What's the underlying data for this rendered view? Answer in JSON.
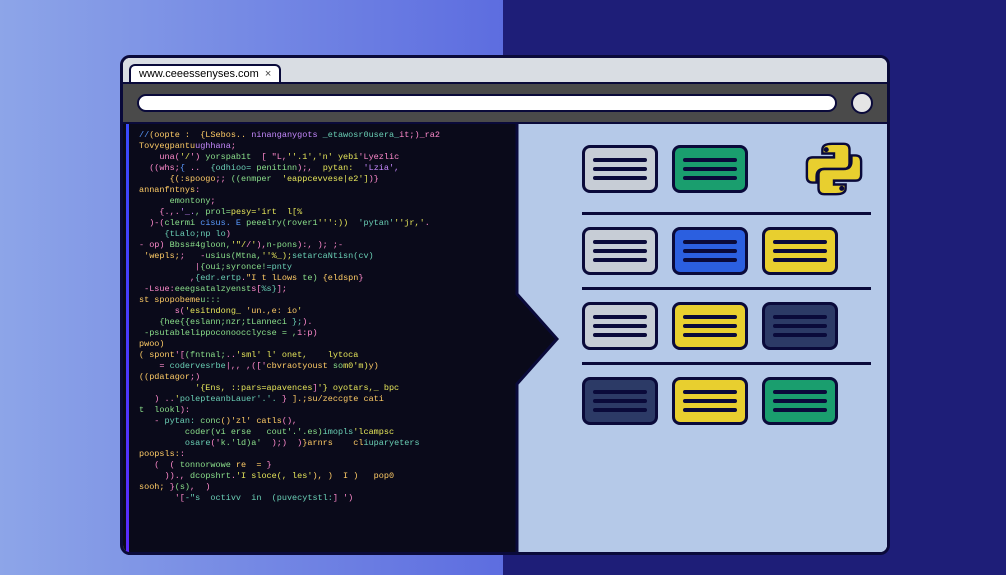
{
  "tab": {
    "url_label": "www.ceeessenyses.com",
    "close": "×"
  },
  "code": {
    "lines": [
      [
        [
          "kw",
          "//"
        ],
        [
          "cm",
          "(oopte :  {LSebos.. "
        ],
        [
          "var",
          "ninanganygots"
        ],
        [
          "op",
          " "
        ],
        [
          "ty",
          "_etawosr0usera_"
        ],
        [
          "op",
          "it;)_ra2"
        ]
      ],
      [
        [
          "cm",
          "Tovyegpantu"
        ],
        [
          "var",
          "ughhana"
        ],
        [
          "op",
          ";"
        ]
      ],
      [
        [
          "op",
          "    una("
        ],
        [
          "str",
          "'/"
        ],
        [
          "op",
          "')"
        ],
        [
          "fn",
          " yorspab1t  "
        ],
        [
          "op",
          "[ \"L,"
        ],
        [
          "str",
          "''.1','n' yebi"
        ],
        [
          "op",
          "'Lyezlic"
        ]
      ],
      [
        [
          "op",
          "  ((whs;"
        ],
        [
          "kw",
          "{"
        ],
        [
          "op",
          " ..  "
        ],
        [
          "ty",
          "{odhioo="
        ],
        [
          "fn",
          " penitinn"
        ],
        [
          "op",
          ");,  "
        ],
        [
          "str",
          "pytan:"
        ],
        [
          "var",
          "  'Lzia',"
        ]
      ],
      [
        [
          "cm",
          "      {(:spoogo"
        ],
        [
          "op",
          ";;"
        ],
        [
          "fn",
          " ((enmper"
        ],
        [
          "str",
          "  'eappcevvese|e2']"
        ],
        [
          "op",
          ")}"
        ]
      ],
      [
        [
          "cm",
          "annanfntnys"
        ],
        [
          "op",
          ":"
        ]
      ],
      [
        [
          "op",
          "      "
        ],
        [
          "fn",
          "emontony"
        ],
        [
          "op",
          ";"
        ]
      ],
      [
        [
          "op",
          "    {.,."
        ],
        [
          "var",
          "'_."
        ],
        [
          "fn",
          ", prol="
        ],
        [
          "str",
          "pesy='irt  l[%"
        ],
        [
          "op",
          ""
        ]
      ],
      [
        [
          "op",
          "  )-("
        ],
        [
          "fn",
          "clermi"
        ],
        [
          "kw",
          " cisus. E"
        ],
        [
          "fn",
          " peeelry(rover1"
        ],
        [
          "str",
          "''':))  "
        ],
        [
          "ty",
          "'pytan'"
        ],
        [
          "str",
          "''jr,'"
        ],
        [
          "op",
          "."
        ]
      ],
      [
        [
          "op",
          "     "
        ],
        [
          "ty",
          "{tLalo;np lo"
        ],
        [
          "op",
          ")"
        ]
      ],
      [
        [
          "op",
          "- op)"
        ],
        [
          "fn",
          " Bbss#4gloon,"
        ],
        [
          "str",
          "'\"/"
        ],
        [
          "op",
          "/"
        ],
        [
          "str",
          "'"
        ],
        [
          "op",
          "),"
        ],
        [
          "fn",
          "n-pons"
        ],
        [
          "op",
          "):, ); ;-"
        ]
      ],
      [
        [
          "cm",
          " 'wepls;"
        ],
        [
          "op",
          ";   -"
        ],
        [
          "fn",
          "usius(Mtna,"
        ],
        [
          "str",
          "''%_);"
        ],
        [
          "ty",
          "setarcaNtisn(cv)"
        ]
      ],
      [
        [
          "op",
          "           |"
        ],
        [
          "fn",
          "{oui;syronce!"
        ],
        [
          "ty",
          "=pnty"
        ]
      ],
      [
        [
          "op",
          "          ,"
        ],
        [
          "ty",
          "{edr.ertp"
        ],
        [
          "op",
          "."
        ],
        [
          "cm",
          "\"I t lLows"
        ],
        [
          "fn",
          " te)"
        ],
        [
          "cm",
          " {eldspn"
        ],
        [
          "op",
          "}"
        ]
      ],
      [
        [
          "op",
          " -Lsue:"
        ],
        [
          "fn",
          "eeegsatalzyenst"
        ],
        [
          "op",
          "s["
        ],
        [
          "ty",
          "%s}"
        ],
        [
          "op",
          "];"
        ]
      ],
      [
        [
          "cm",
          "st spopobeme"
        ],
        [
          "fn",
          "u:::"
        ]
      ],
      [
        [
          "op",
          "       s("
        ],
        [
          "str",
          "'esitndong_"
        ],
        [
          "cm",
          " 'un.,e: io"
        ],
        [
          "str",
          "'"
        ]
      ],
      [
        [
          "op",
          "    "
        ],
        [
          "fn",
          "{hee{{eslann;nzr;tLanneci"
        ],
        [
          "ty",
          " };"
        ],
        [
          "op",
          ")."
        ]
      ],
      [
        [
          "op",
          " "
        ],
        [
          "fn",
          "-psutablelippoconoocclycse = ,"
        ],
        [
          "op",
          "1:p)"
        ]
      ],
      [
        [
          "cm",
          "pwoo)"
        ]
      ],
      [
        [
          "cm",
          "( spont"
        ],
        [
          "op",
          "'["
        ],
        [
          "fn",
          "(fntnal;"
        ],
        [
          "op",
          ".."
        ],
        [
          "str",
          "'sml' l' onet,    lytoca  "
        ]
      ],
      [
        [
          "op",
          "    ="
        ],
        [
          "ty",
          " codervesrbe"
        ],
        [
          "op",
          "|,, ,(['"
        ],
        [
          "cm",
          "cbvraotyoust "
        ],
        [
          "fn",
          "so"
        ],
        [
          "str",
          "m0'm)"
        ],
        [
          "cm",
          "y)"
        ]
      ],
      [
        [
          "cm",
          "((pdatagor"
        ],
        [
          "op",
          ";)"
        ]
      ],
      [
        [
          "op",
          "           "
        ],
        [
          "str",
          "'{Ens, ::pars=apavences"
        ],
        [
          "op",
          "]"
        ],
        [
          "str",
          "'} oyotars,_ bpc"
        ]
      ],
      [
        [
          "op",
          "   ) .."
        ],
        [
          "str",
          "'"
        ],
        [
          "ty",
          "polepteanbLauer'.'. "
        ],
        [
          "op",
          "}"
        ],
        [
          "cm",
          " ].;su/zeccgte cati"
        ]
      ],
      [
        [
          "fn",
          "t  lookl"
        ],
        [
          "op",
          "):"
        ]
      ],
      [
        [
          "op",
          "   -"
        ],
        [
          "ty",
          " pytan: "
        ],
        [
          "fn",
          "conc"
        ],
        [
          "cm",
          "()'zl' catls"
        ],
        [
          "op",
          "(),"
        ]
      ],
      [
        [
          "op",
          "         "
        ],
        [
          "fn",
          "coder(vi erse   cout'.'.es)"
        ],
        [
          "ty",
          "imopls"
        ],
        [
          "str",
          "'lcampsc"
        ]
      ],
      [
        [
          "op",
          "         "
        ],
        [
          "ty",
          "osare"
        ],
        [
          "op",
          "('"
        ],
        [
          "fn",
          "k.'ld)a'"
        ],
        [
          "op",
          "  );)  )"
        ],
        [
          "cm",
          "}arnrs    cl"
        ],
        [
          "ty",
          "iuparyeters"
        ]
      ],
      [
        [
          "cm",
          "poopsls:"
        ],
        [
          "op",
          ":"
        ]
      ],
      [
        [
          "op",
          "   (  ( "
        ],
        [
          "fn",
          "tonnorwowe"
        ],
        [
          "cm",
          " re  = "
        ],
        [
          "op",
          "}"
        ]
      ],
      [
        [
          "op",
          "     ))., "
        ],
        [
          "fn",
          "dcopshrt"
        ],
        [
          "op",
          "."
        ],
        [
          "str",
          "'I sloce(, les'"
        ],
        [
          "cm",
          "), )  I )   pop0"
        ]
      ],
      [
        [
          "cm",
          "sooh; "
        ],
        [
          "op",
          "}"
        ],
        [
          "fn",
          "(s)"
        ],
        [
          "op",
          ",  )"
        ]
      ],
      [
        [
          "op",
          "       '["
        ],
        [
          "ty",
          "-\"s  octivv  in  (puvecytstl:"
        ],
        [
          "op",
          "] ')"
        ]
      ]
    ]
  },
  "cards": {
    "rows": [
      [
        {
          "style": "grey"
        },
        {
          "style": "green"
        }
      ],
      [
        {
          "style": "grey"
        },
        {
          "style": "blue"
        },
        {
          "style": "yellow"
        }
      ],
      [
        {
          "style": "grey"
        },
        {
          "style": "yellow"
        },
        {
          "style": "navy"
        }
      ],
      [
        {
          "style": "navy"
        },
        {
          "style": "yellow"
        },
        {
          "style": "green"
        }
      ]
    ]
  }
}
